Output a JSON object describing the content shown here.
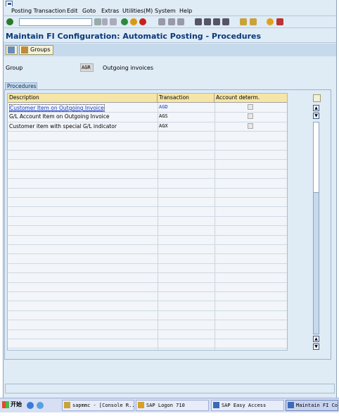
{
  "menu": [
    "Posting Transaction",
    "Edit",
    "Goto",
    "Extras",
    "Utilities(M)",
    "System",
    "Help"
  ],
  "title": "Maintain FI Configuration: Automatic Posting - Procedures",
  "app_toolbar": {
    "groups_label": "Groups"
  },
  "group": {
    "label": "Group",
    "value": "AGR",
    "description": "Outgoing invoices"
  },
  "procedures": {
    "tab_label": "Procedures",
    "columns": [
      "Description",
      "Transaction",
      "Account determ."
    ],
    "rows": [
      {
        "description": "Customer Item on Outgoing Invoice",
        "transaction": "AGD",
        "account_determ": false
      },
      {
        "description": "G/L Account Item on Outgoing Invoice",
        "transaction": "AGS",
        "account_determ": false
      },
      {
        "description": "Customer item with special G/L indicator",
        "transaction": "AGX",
        "account_determ": false
      }
    ]
  },
  "taskbar": {
    "start_label": "开始",
    "tasks": [
      "sapmmc - [Console R...",
      "SAP Logon 710",
      "SAP Easy Access",
      "Maintain FI Conf"
    ]
  },
  "colors": {
    "title": "#0a3a7a",
    "header": "#f5e5a6",
    "link": "#1a3cc8"
  }
}
